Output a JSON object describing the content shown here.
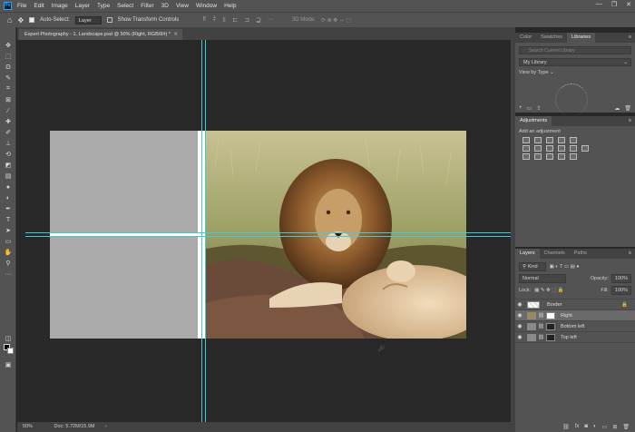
{
  "app": {
    "logo": "Ps"
  },
  "menu": [
    "File",
    "Edit",
    "Image",
    "Layer",
    "Type",
    "Select",
    "Filter",
    "3D",
    "View",
    "Window",
    "Help"
  ],
  "window_controls": {
    "minimize": "—",
    "restore": "❐",
    "close": "✕"
  },
  "options": {
    "auto_select_label": "Auto-Select:",
    "auto_select_value": "Layer",
    "show_transform_label": "Show Transform Controls",
    "mode_3d": "3D Mode:"
  },
  "document": {
    "tab_title": "Expert Photography - 1. Landscape.psd @ 50% (Right, RGB/8#) *"
  },
  "status": {
    "zoom": "50%",
    "doc": "Doc: 5.72M/15.9M"
  },
  "panels": {
    "top_tabs": [
      "Color",
      "Swatches",
      "Libraries"
    ],
    "search_placeholder": "Search Current Library",
    "library": "My Library",
    "view_by": "View by Type",
    "adjustments_title": "Adjustments",
    "add_adjustment": "Add an adjustment",
    "layers_tabs": [
      "Layers",
      "Channels",
      "Paths"
    ],
    "kind": "Kind",
    "blend": "Normal",
    "opacity_label": "Opacity:",
    "opacity_value": "100%",
    "lock_label": "Lock:",
    "fill_label": "Fill:",
    "fill_value": "100%"
  },
  "layers": [
    {
      "name": "Border",
      "selected": false
    },
    {
      "name": "Right",
      "selected": true
    },
    {
      "name": "Bottom left",
      "selected": false
    },
    {
      "name": "Top left",
      "selected": false
    }
  ],
  "colors": {
    "accent": "#31a8ff",
    "guide": "#45c8d8",
    "canvas_bg": "#282828",
    "ui": "#535353"
  }
}
